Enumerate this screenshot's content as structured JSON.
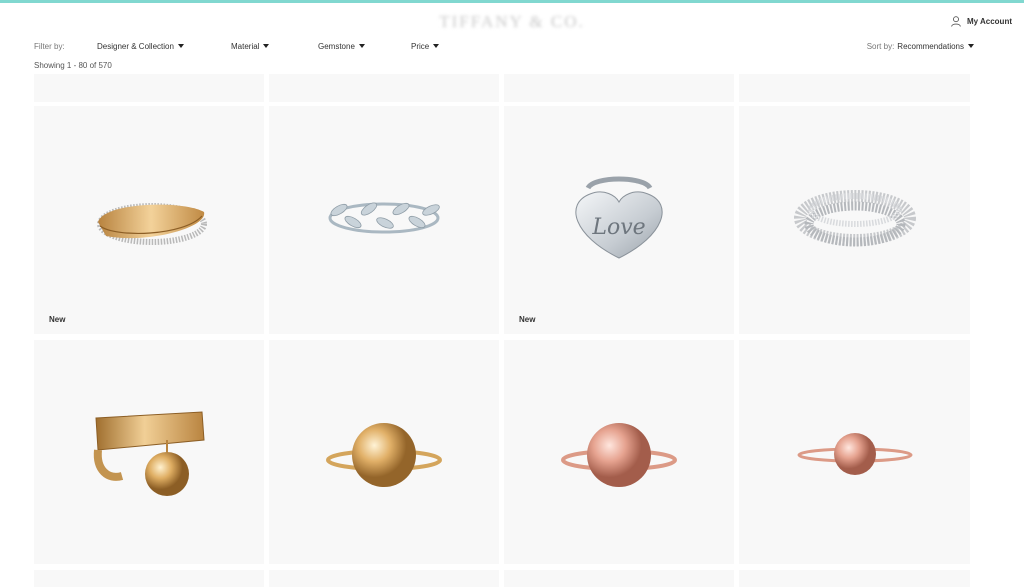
{
  "header": {
    "logo_text": "TIFFANY & CO.",
    "account_label": "My Account",
    "account_icon": "user-icon"
  },
  "filters": {
    "label": "Filter by:",
    "items": [
      {
        "label": "Designer & Collection"
      },
      {
        "label": "Material"
      },
      {
        "label": "Gemstone"
      },
      {
        "label": "Price"
      }
    ],
    "dropdown_icon": "caret-down-icon"
  },
  "sort": {
    "label": "Sort by:",
    "value": "Recommendations"
  },
  "results": {
    "showing": "Showing 1 - 80 of 570"
  },
  "products": [
    {
      "badge": "New",
      "image": "gold-diamond-crossover-ring"
    },
    {
      "badge": "",
      "image": "silver-olive-leaf-ring"
    },
    {
      "badge": "New",
      "image": "silver-love-heart-ring"
    },
    {
      "badge": "",
      "image": "diamond-pave-woven-ring"
    },
    {
      "badge": "",
      "image": "gold-padlock-bead-ring"
    },
    {
      "badge": "",
      "image": "gold-bead-ring"
    },
    {
      "badge": "",
      "image": "rose-gold-bead-ring"
    },
    {
      "badge": "",
      "image": "rose-gold-small-bead-ring"
    }
  ],
  "colors": {
    "brand_accent": "#81d8d0",
    "tile_background": "#f8f8f8",
    "gold": "#d9a85a",
    "rose_gold": "#e6a390",
    "silver": "#c9d3da"
  }
}
